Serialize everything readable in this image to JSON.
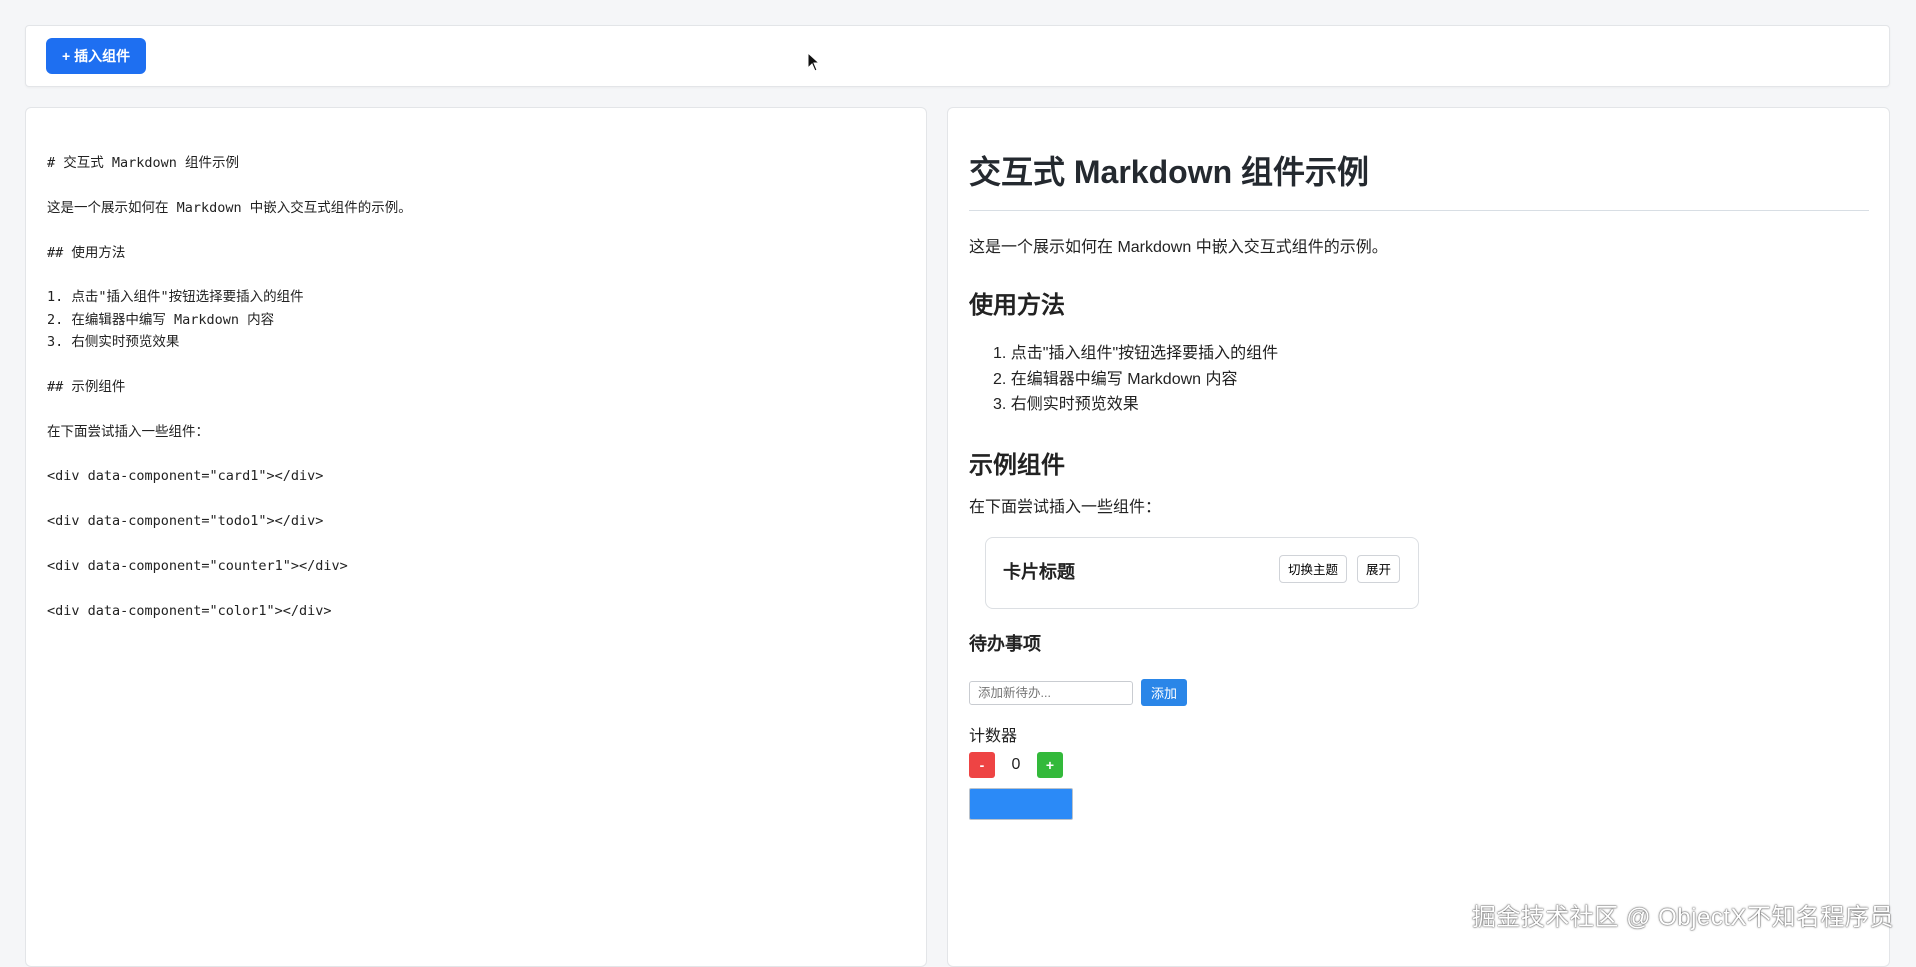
{
  "toolbar": {
    "insert_button_icon": "plus-icon",
    "insert_button_label": "+ 插入组件"
  },
  "editor": {
    "lines": [
      "# 交互式 Markdown 组件示例",
      "",
      "这是一个展示如何在 Markdown 中嵌入交互式组件的示例。",
      "",
      "## 使用方法",
      "",
      "1. 点击\"插入组件\"按钮选择要插入的组件",
      "2. 在编辑器中编写 Markdown 内容",
      "3. 右侧实时预览效果",
      "",
      "## 示例组件",
      "",
      "在下面尝试插入一些组件：",
      "",
      "<div data-component=\"card1\"></div>",
      "",
      "<div data-component=\"todo1\"></div>",
      "",
      "<div data-component=\"counter1\"></div>",
      "",
      "<div data-component=\"color1\"></div>"
    ]
  },
  "preview": {
    "h1": "交互式 Markdown 组件示例",
    "intro": "这是一个展示如何在 Markdown 中嵌入交互式组件的示例。",
    "usage_heading": "使用方法",
    "usage_steps": [
      "1. 点击\"插入组件\"按钮选择要插入的组件",
      "2. 在编辑器中编写 Markdown 内容",
      "3. 右侧实时预览效果"
    ],
    "examples_heading": "示例组件",
    "examples_intro": "在下面尝试插入一些组件：",
    "card": {
      "title": "卡片标题",
      "theme_button": "切换主题",
      "expand_button": "展开"
    },
    "todo": {
      "title": "待办事项",
      "input_placeholder": "添加新待办...",
      "add_button": "添加"
    },
    "counter": {
      "label": "计数器",
      "minus": "-",
      "value": "0",
      "plus": "+"
    },
    "color_picker": {
      "value": "#2b8af7"
    }
  },
  "watermark": "掘金技术社区 @ ObjectX不知名程序员",
  "colors": {
    "primary": "#1e6ff1",
    "add_button": "#2a86e8",
    "minus_button": "#ee4444",
    "plus_button": "#33b93b"
  }
}
